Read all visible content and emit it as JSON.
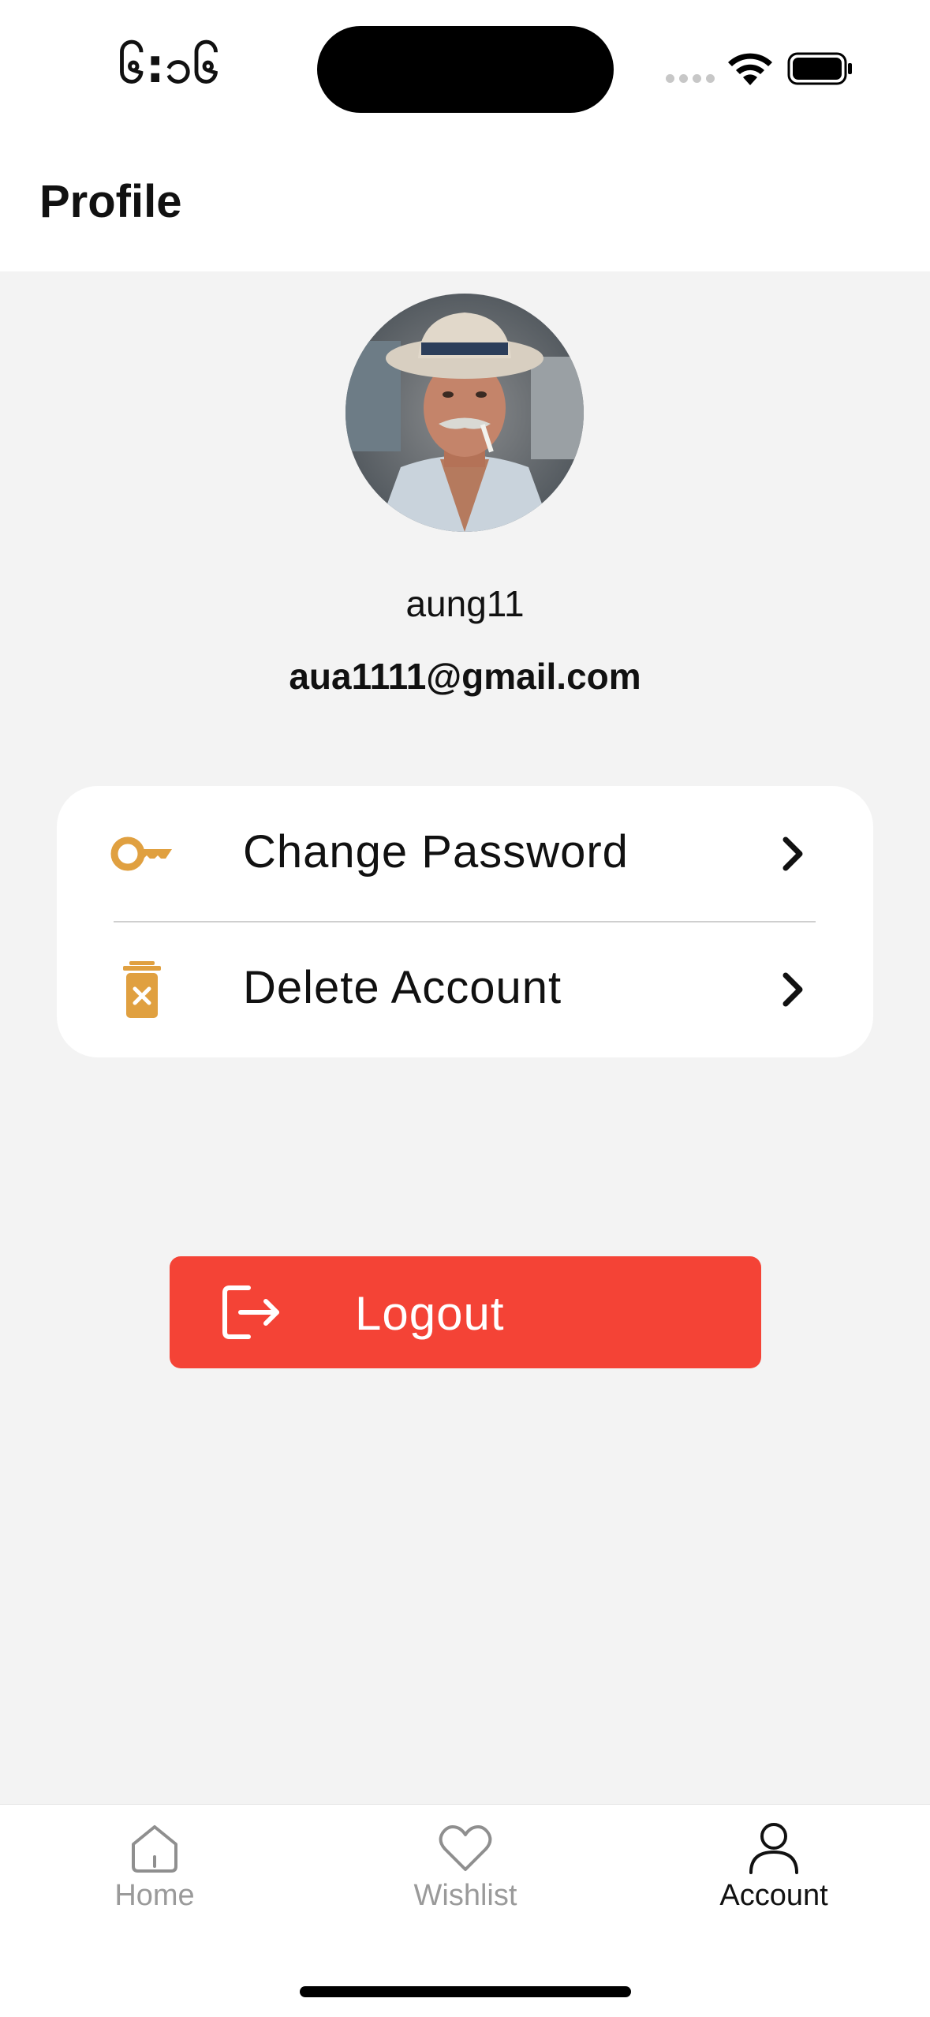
{
  "status_bar": {
    "time": "၆:၁၆"
  },
  "header": {
    "title": "Profile"
  },
  "profile": {
    "username": "aung11",
    "email": "aua1111@gmail.com"
  },
  "menu": {
    "items": [
      {
        "label": "Change Password",
        "icon": "key-icon"
      },
      {
        "label": "Delete Account",
        "icon": "trash-icon"
      }
    ]
  },
  "logout": {
    "label": "Logout",
    "icon": "logout-icon"
  },
  "tabbar": {
    "tabs": [
      {
        "label": "Home",
        "icon": "home-icon",
        "active": false
      },
      {
        "label": "Wishlist",
        "icon": "heart-icon",
        "active": false
      },
      {
        "label": "Account",
        "icon": "person-icon",
        "active": true
      }
    ]
  },
  "colors": {
    "accent": "#e0a040",
    "logout": "#f44336",
    "background": "#f3f3f3",
    "card": "#ffffff"
  }
}
